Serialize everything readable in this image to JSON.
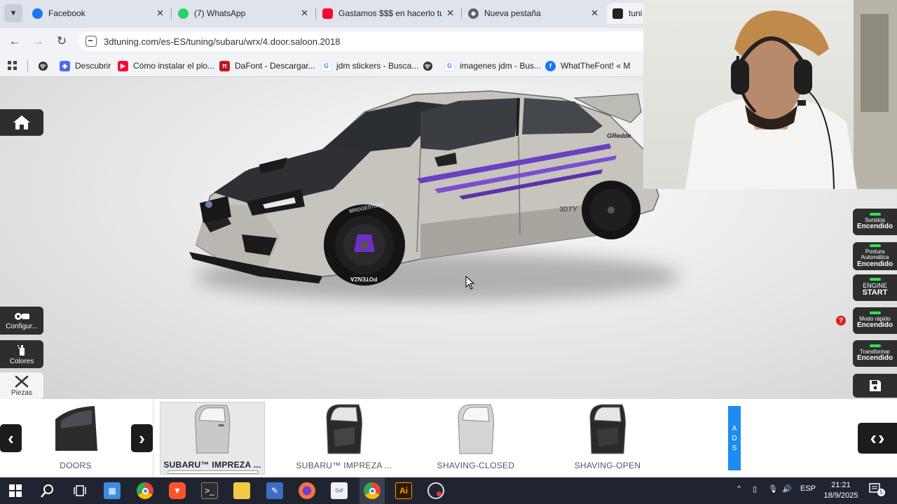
{
  "browser": {
    "tabs": [
      {
        "title": "Facebook",
        "icon": "facebook-icon",
        "color": "#1877f2"
      },
      {
        "title": "(7) WhatsApp",
        "icon": "whatsapp-icon",
        "color": "#25d366"
      },
      {
        "title": "Gastamos $$$ en hacerlo tu",
        "icon": "youtube-icon",
        "color": "#ff0033"
      },
      {
        "title": "Nueva pestaña",
        "icon": "chrome-icon",
        "color": "#5f6368"
      },
      {
        "title": "tuni",
        "icon": "3dtuning-icon",
        "color": "#222222"
      }
    ],
    "url": "3dtuning.com/es-ES/tuning/subaru/wrx/4.door.saloon.2018",
    "bookmarks": [
      {
        "label": "Descubrir",
        "icon": "discover-icon",
        "color": "#4a6cf7"
      },
      {
        "label": "Cómo instalar el plo...",
        "icon": "youtube-icon",
        "color": "#ff0033"
      },
      {
        "label": "DaFont - Descargar...",
        "icon": "dafont-icon",
        "color": "#c4161c"
      },
      {
        "label": "jdm stickers - Busca...",
        "icon": "google-icon",
        "color": "#4285f4"
      },
      {
        "label": "imagenes jdm - Bus...",
        "icon": "google-icon",
        "color": "#4285f4"
      },
      {
        "label": "WhatTheFont! « M",
        "icon": "facebook-icon",
        "color": "#1877f2"
      }
    ]
  },
  "left_menu": {
    "home": "home-icon",
    "config": "Configur...",
    "colors": "Colores",
    "parts": "Piezas"
  },
  "right_menu": [
    {
      "line1": "Sonidos",
      "line2": "Encendido"
    },
    {
      "line1": "Postura Automática",
      "line2": "Encendido"
    },
    {
      "line1": "ENGINE",
      "line2": "START"
    },
    {
      "line1": "Modo rápido",
      "line2": "Encendido"
    },
    {
      "line1": "Transformar",
      "line2": "Encendido"
    }
  ],
  "help_badge": "?",
  "car": {
    "brand_sticker": "GRedde",
    "tire_text": "BRIDGESTONE",
    "tire_text2": "POTENZA",
    "logo": "3DTY"
  },
  "parts": {
    "category": "DOORS",
    "items": [
      {
        "label": "SUBARU™ IMPREZA ...",
        "selected": true
      },
      {
        "label": "SUBARU™ IMPREZA ...",
        "selected": false
      },
      {
        "label": "SHAVING-CLOSED",
        "selected": false
      },
      {
        "label": "SHAVING-OPEN",
        "selected": false
      }
    ],
    "ads": [
      "A",
      "D",
      "S"
    ]
  },
  "taskbar": {
    "language": "ESP",
    "time": "21:21",
    "date": "18/9/2025",
    "notifications": "5"
  }
}
